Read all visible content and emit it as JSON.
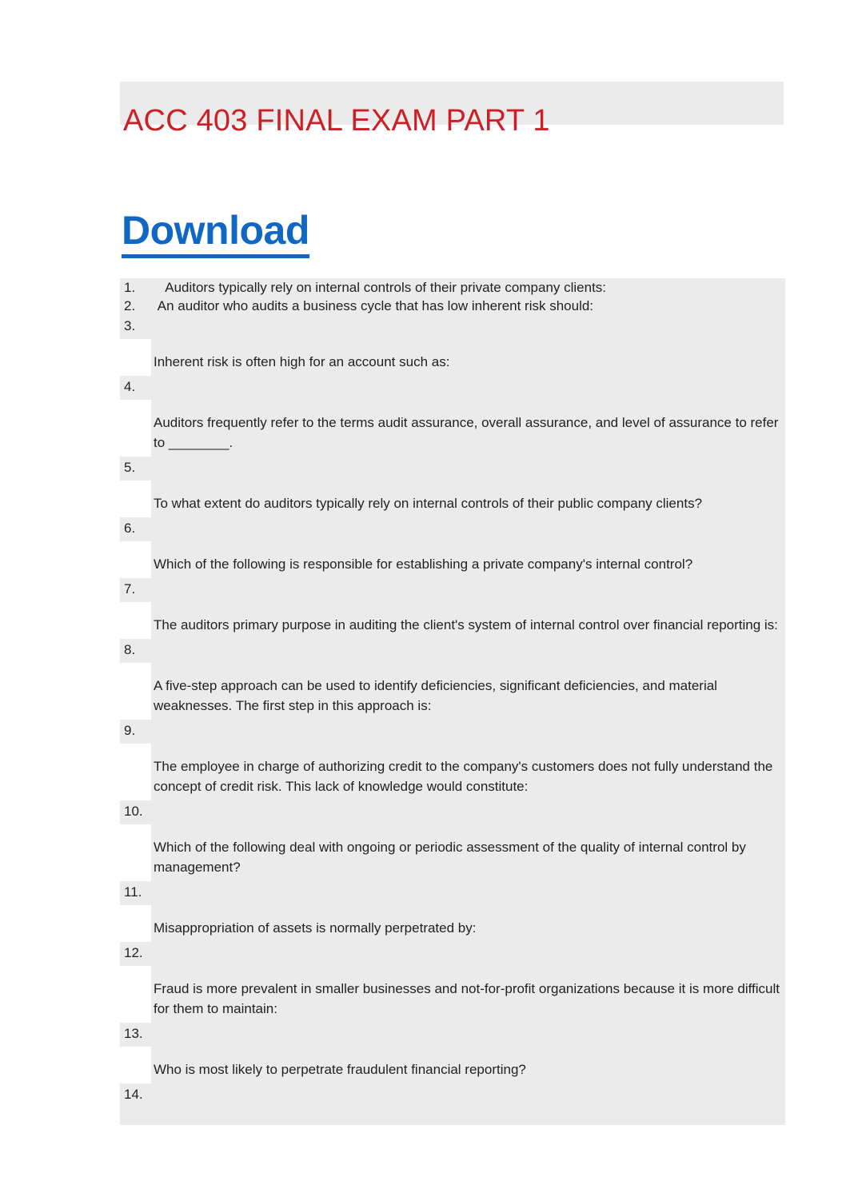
{
  "document": {
    "title": "ACC 403 FINAL EXAM PART 1",
    "download_label": "Download"
  },
  "colors": {
    "title_red": "#cc2027",
    "link_blue": "#1168c4",
    "block_gray": "#ebebeb",
    "body_text": "#231f20",
    "page_white": "#ffffff"
  },
  "questions": [
    {
      "number": "1.",
      "layout": "inline",
      "text": "   Auditors typically rely on internal controls of their private company clients:"
    },
    {
      "number": "2.",
      "layout": "inline",
      "text": " An auditor who audits a business cycle that has low inherent risk should:"
    },
    {
      "number": "3.",
      "layout": "block",
      "text": "Inherent risk is often high for an account such as:"
    },
    {
      "number": "4.",
      "layout": "block",
      "text": "Auditors frequently refer to the terms audit assurance, overall assurance, and level of assurance to refer to ________."
    },
    {
      "number": "5.",
      "layout": "block",
      "text": "To what extent do auditors typically rely on internal controls of their public company clients?"
    },
    {
      "number": "6.",
      "layout": "block",
      "text": "Which of the following is responsible for establishing a private company's internal control?"
    },
    {
      "number": "7.",
      "layout": "block",
      "text": "The auditors primary purpose in auditing the client's system of internal control over financial reporting is:"
    },
    {
      "number": "8.",
      "layout": "block",
      "text": "A five-step approach can be used to identify deficiencies, significant deficiencies, and material weaknesses. The first step in this approach is:"
    },
    {
      "number": "9.",
      "layout": "block",
      "text": "The employee in charge of authorizing credit to the company's customers does not fully understand the concept of credit risk. This lack of knowledge would constitute:"
    },
    {
      "number": "10.",
      "layout": "block",
      "text": "Which of the following deal with ongoing or periodic assessment of the quality of internal control by management?"
    },
    {
      "number": "11.",
      "layout": "block",
      "text": "Misappropriation of assets is normally perpetrated by:"
    },
    {
      "number": "12.",
      "layout": "block",
      "text": "Fraud is more prevalent in smaller businesses and not-for-profit organizations because it is more difficult for them to maintain:"
    },
    {
      "number": "13.",
      "layout": "block",
      "text": "Who is most likely to perpetrate fraudulent financial reporting?"
    },
    {
      "number": "14.",
      "layout": "empty",
      "text": ""
    }
  ]
}
